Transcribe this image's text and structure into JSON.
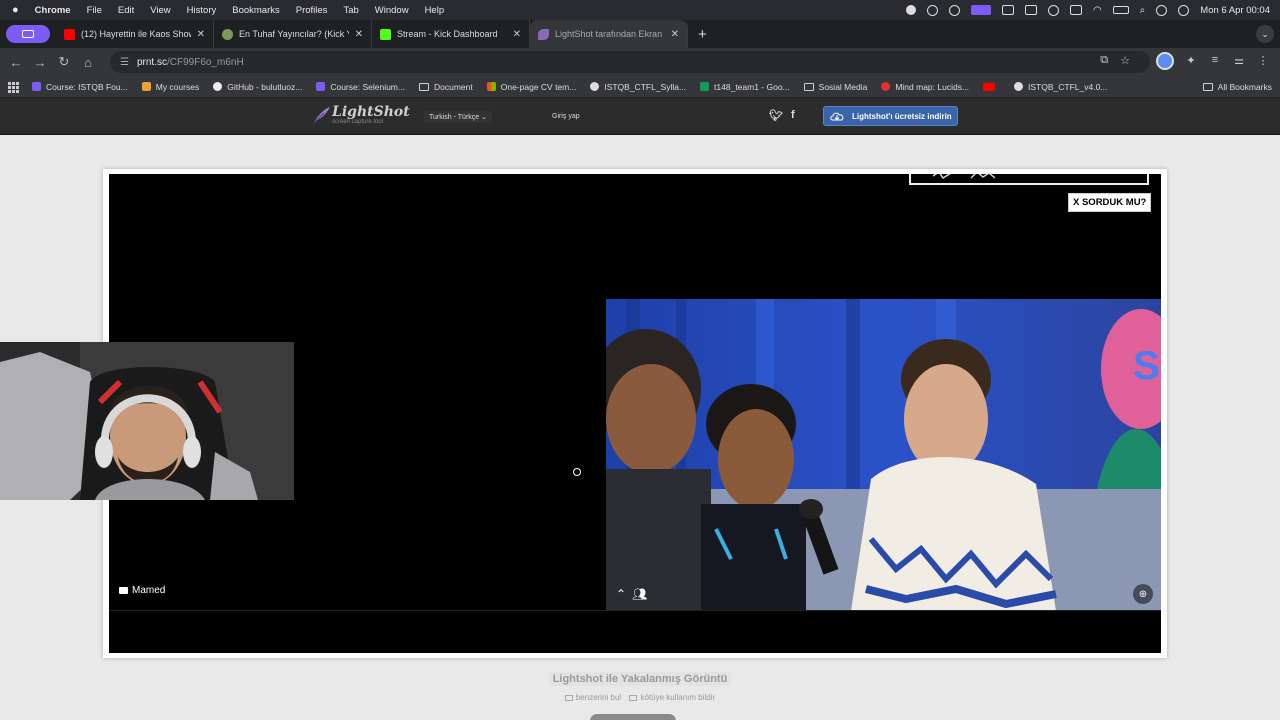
{
  "menubar": {
    "app": "Chrome",
    "items": [
      "File",
      "Edit",
      "View",
      "History",
      "Bookmarks",
      "Profiles",
      "Tab",
      "Window",
      "Help"
    ],
    "clock": "Mon 6 Apr  00:04"
  },
  "tabs": [
    {
      "title": "(12) Hayrettin ile Kaos Show",
      "favicon_color": "#ff0000"
    },
    {
      "title": "En Tuhaf Yayıncılar? (Kick Ya",
      "favicon_color": "#7a9a5a"
    },
    {
      "title": "Stream - Kick Dashboard",
      "favicon_color": "#53fc18"
    },
    {
      "title": "LightShot tarafından Ekran Gö",
      "favicon_color": "#8a6ab8"
    }
  ],
  "address": {
    "domain": "prnt.sc",
    "path": "/CF99F6o_m6nH"
  },
  "bookmarks": [
    {
      "label": "Course: ISTQB Fou...",
      "color": "#7c5cf5"
    },
    {
      "label": "My courses",
      "color": "#f0a030"
    },
    {
      "label": "GitHub - bulutluoz...",
      "color": "#eeeeee"
    },
    {
      "label": "Course: Selenium...",
      "color": "#7c5cf5"
    },
    {
      "label": "Document",
      "color": "folder"
    },
    {
      "label": "One-page CV tem...",
      "color": "#f25022"
    },
    {
      "label": "ISTQB_CTFL_Sylla...",
      "color": "#dddddd"
    },
    {
      "label": "t148_team1 - Goo...",
      "color": "#0f9d58"
    },
    {
      "label": "Sosial Media",
      "color": "folder"
    },
    {
      "label": "Mind map: Lucids...",
      "color": "#e03030"
    },
    {
      "label": "",
      "color": "#ff0000"
    },
    {
      "label": "ISTQB_CTFL_v4.0...",
      "color": "#dddddd"
    }
  ],
  "all_bookmarks": "All Bookmarks",
  "lightshot": {
    "logo": "LightShot",
    "tagline": "screen capture tool",
    "language": "Turkish - Türkçe",
    "login": "Giriş yap",
    "social": [
      "twitter",
      "f"
    ],
    "download": "Lightshot'ı ücretsiz indirin"
  },
  "screenshot": {
    "sticker": "X SORDUK MU?",
    "username": "Mamed"
  },
  "footer": {
    "caption": "Lightshot ile Yakalanmış Görüntü",
    "link_similar": "benzerini bul",
    "link_report": "kötüye kullanım bildir"
  }
}
